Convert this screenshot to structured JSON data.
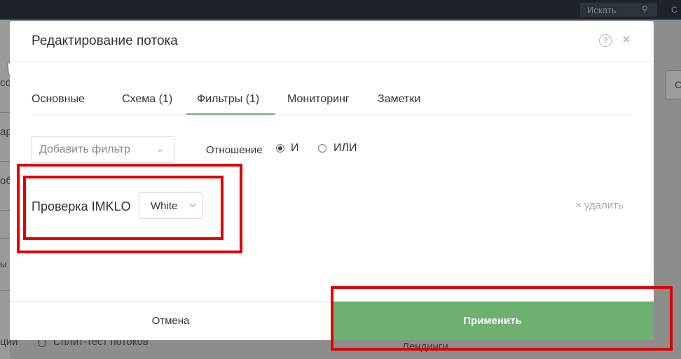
{
  "background": {
    "search_placeholder": "Искать",
    "search_icon": "search-icon",
    "top_right_fragment": "С",
    "left_fragments": [
      "со",
      "ар",
      "об",
      "ы"
    ],
    "right_button_fragment": "С",
    "bottom_left_fragment": "ции",
    "bottom_radio_label": "Сплит-тест потоков",
    "bottom_right_fragment": "Лендинги"
  },
  "modal": {
    "title": "Редактирование потока",
    "help_icon": "question-circle-icon",
    "help_glyph": "?",
    "close_icon": "close-icon",
    "close_glyph": "×",
    "tabs": [
      {
        "label": "Основные",
        "active": false
      },
      {
        "label": "Схема (1)",
        "active": false
      },
      {
        "label": "Фильтры (1)",
        "active": true
      },
      {
        "label": "Мониторинг",
        "active": false
      },
      {
        "label": "Заметки",
        "active": false
      }
    ],
    "filters_panel": {
      "add_filter_placeholder": "Добавить фильтр",
      "relation_label": "Отношение",
      "relation_options": [
        {
          "label": "И",
          "selected": true
        },
        {
          "label": "ИЛИ",
          "selected": false
        }
      ],
      "filter": {
        "name": "Проверка IMKLO",
        "value": "White",
        "delete_label": "удалить",
        "delete_glyph": "×"
      }
    },
    "footer": {
      "cancel_label": "Отмена",
      "apply_label": "Применить"
    }
  },
  "colors": {
    "accent_green": "#6db06f",
    "highlight_red": "#e00000",
    "top_bar": "#1d2328"
  }
}
